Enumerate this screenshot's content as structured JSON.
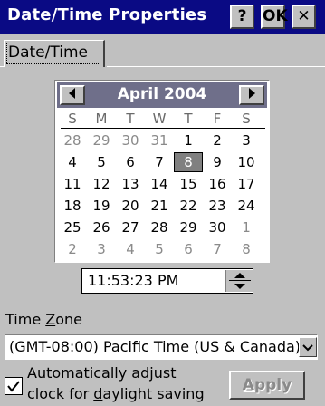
{
  "window": {
    "title": "Date/Time Properties",
    "help_label": "?",
    "ok_label": "OK",
    "close_label": "✕"
  },
  "tabs": [
    {
      "label": "Date/Time",
      "selected": true
    }
  ],
  "calendar": {
    "month_title": "April 2004",
    "prev_icon": "arrow-left",
    "next_icon": "arrow-right",
    "weekdays": [
      "S",
      "M",
      "T",
      "W",
      "T",
      "F",
      "S"
    ],
    "weeks": [
      [
        "28",
        "29",
        "30",
        "31",
        "1",
        "2",
        "3"
      ],
      [
        "4",
        "5",
        "6",
        "7",
        "8",
        "9",
        "10"
      ],
      [
        "11",
        "12",
        "13",
        "14",
        "15",
        "16",
        "17"
      ],
      [
        "18",
        "19",
        "20",
        "21",
        "22",
        "23",
        "24"
      ],
      [
        "25",
        "26",
        "27",
        "28",
        "29",
        "30",
        "1"
      ],
      [
        "2",
        "3",
        "4",
        "5",
        "6",
        "7",
        "8"
      ]
    ],
    "selected_day": "8"
  },
  "time": {
    "value": "11:53:23 PM"
  },
  "timezone": {
    "label_pre": "Time ",
    "label_accel": "Z",
    "label_post": "one",
    "value": "(GMT-08:00) Pacific Time (US & Canada)"
  },
  "dst": {
    "checked": true,
    "line1": "Automatically adjust",
    "line2_pre": "clock for ",
    "line2_accel": "d",
    "line2_post": "aylight saving"
  },
  "apply": {
    "accel": "A",
    "rest": "pply",
    "enabled": false
  },
  "colors": {
    "titlebar": "#0a0a84",
    "dialog_bg": "#c0c0c0",
    "calendar_header": "#6f6f8a",
    "disabled_text": "#8a8a8a"
  }
}
